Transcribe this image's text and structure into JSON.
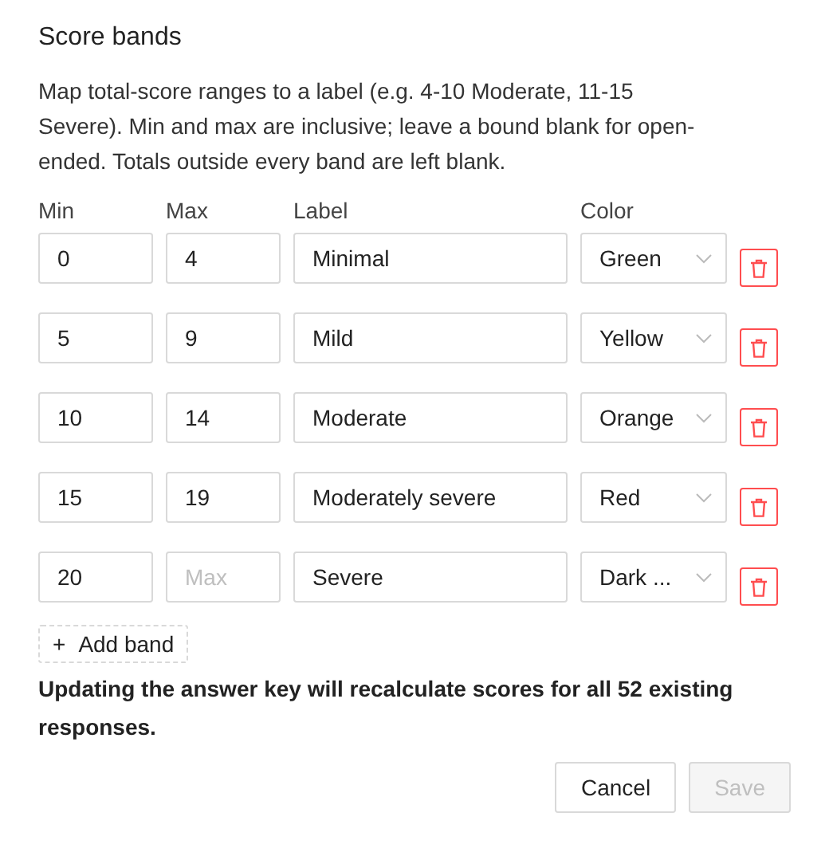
{
  "title": "Score bands",
  "description": "Map total-score ranges to a label (e.g. 4-10 Moderate, 11-15 Severe). Min and max are inclusive; leave a bound blank for open-ended. Totals outside every band are left blank.",
  "columns": [
    "Min",
    "Max",
    "Label",
    "Color"
  ],
  "bands": [
    {
      "min": "0",
      "max": "4",
      "label": "Minimal",
      "color_name": "Green"
    },
    {
      "min": "5",
      "max": "9",
      "label": "Mild",
      "color_name": "Yellow"
    },
    {
      "min": "10",
      "max": "14",
      "label": "Moderate",
      "color_name": "Orange"
    },
    {
      "min": "15",
      "max": "19",
      "label": "Moderately severe",
      "color_name": "Red"
    },
    {
      "min": "20",
      "max_placeholder": "Max",
      "label": "Severe",
      "color_name": "Dark ..."
    }
  ],
  "add_button": {
    "icon": "+",
    "label": "Add band"
  },
  "warning": "Updating the answer key will recalculate scores for all 52 existing responses.",
  "buttons": [
    {
      "label": "Cancel",
      "disabled": false
    },
    {
      "label": "Save",
      "disabled": true
    }
  ]
}
